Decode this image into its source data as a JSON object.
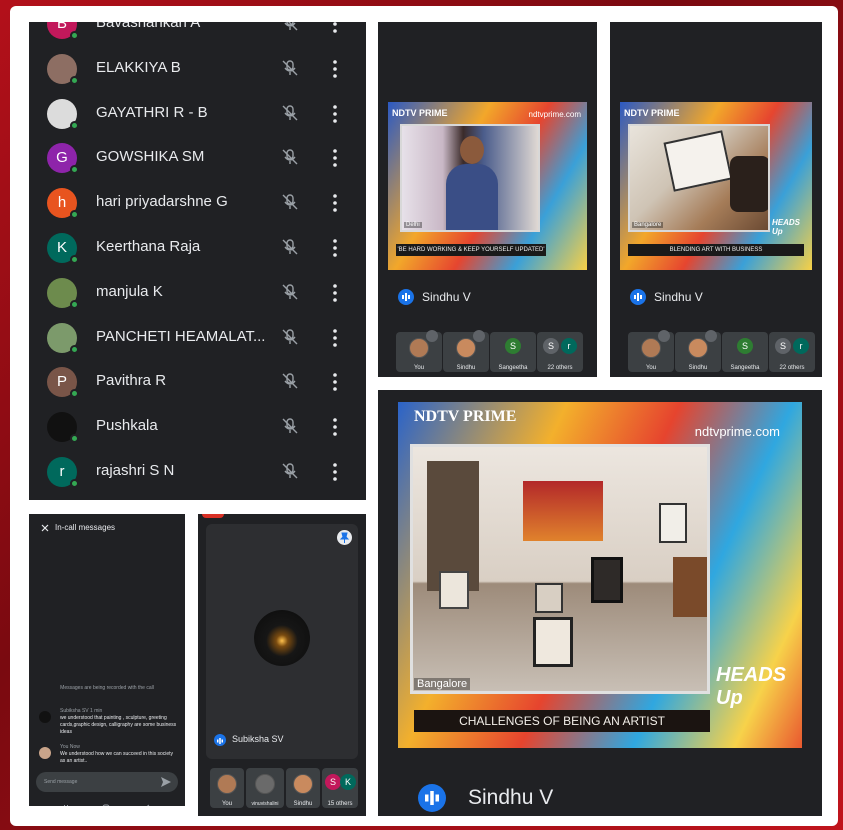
{
  "participants": {
    "items": [
      {
        "name": "Bavashankari A",
        "initial": "B",
        "color": "#c2185b",
        "photo": false
      },
      {
        "name": "ELAKKIYA B",
        "initial": "",
        "color": "#8d6e63",
        "photo": true
      },
      {
        "name": "GAYATHRI R - B",
        "initial": "",
        "color": "#dcdcdc",
        "photo": true
      },
      {
        "name": "GOWSHIKA SM",
        "initial": "G",
        "color": "#8e24aa",
        "photo": false
      },
      {
        "name": "hari priyadarshne G",
        "initial": "h",
        "color": "#e8541f",
        "photo": false
      },
      {
        "name": "Keerthana Raja",
        "initial": "K",
        "color": "#00695c",
        "photo": false
      },
      {
        "name": "manjula K",
        "initial": "",
        "color": "#6d8b4d",
        "photo": true
      },
      {
        "name": "PANCHETI HEAMALAT...",
        "initial": "",
        "color": "#7c9a6b",
        "photo": true
      },
      {
        "name": "Pavithra R",
        "initial": "P",
        "color": "#795548",
        "photo": false
      },
      {
        "name": "Pushkala",
        "initial": "",
        "color": "#111111",
        "photo": true
      },
      {
        "name": "rajashri S N",
        "initial": "r",
        "color": "#00695c",
        "photo": false
      }
    ]
  },
  "call_a": {
    "tv": {
      "logo": "NDTV PRIME",
      "site": "ndtvprime.com",
      "location": "Delhi",
      "ticker": "'BE HARD WORKING & KEEP YOURSELF UPDATED'"
    },
    "speaker": "Sindhu V",
    "thumbs": [
      {
        "label": "You"
      },
      {
        "label": "Sindhu"
      },
      {
        "label": "Sangeetha",
        "initial": "S"
      },
      {
        "label": "22 others",
        "initials": [
          "S",
          "r"
        ]
      }
    ]
  },
  "call_b": {
    "tv": {
      "logo": "NDTV PRIME",
      "location": "Bangalore",
      "ticker": "BLENDING ART WITH BUSINESS",
      "brand": "HEADS Up"
    },
    "speaker": "Sindhu V",
    "thumbs": [
      {
        "label": "You"
      },
      {
        "label": "Sindhu"
      },
      {
        "label": "Sangeetha",
        "initial": "S"
      },
      {
        "label": "22 others",
        "initials": [
          "S",
          "r"
        ]
      }
    ]
  },
  "messages": {
    "title": "In-call messages",
    "recording_note": "Messages are being recorded with the call",
    "items": [
      {
        "sender": "Subiksha SV",
        "time": "1 min",
        "text": "we understood that painting , sculpture, greeting cards,graphic design, calligraphy are some business ideas"
      },
      {
        "sender": "You",
        "time": "Now",
        "text": "We understood how we can succeed in this society as an artist.."
      }
    ],
    "placeholder": "Send message"
  },
  "call_c": {
    "speaker": "Subiksha SV",
    "thumbs": [
      {
        "label": "You"
      },
      {
        "label": "vinuvishalini"
      },
      {
        "label": "Sindhu"
      },
      {
        "label": "15 others",
        "initials": [
          "S",
          "K"
        ]
      }
    ]
  },
  "call_d": {
    "tv": {
      "logo": "NDTV PRIME",
      "site": "ndtvprime.com",
      "location": "Bangalore",
      "ticker": "CHALLENGES OF BEING AN ARTIST",
      "brand": "HEADS Up"
    },
    "speaker": "Sindhu V"
  },
  "colors": {
    "meet_dark": "#202124",
    "accent": "#1a73e8",
    "online": "#34a853",
    "background": "#b3101a"
  }
}
